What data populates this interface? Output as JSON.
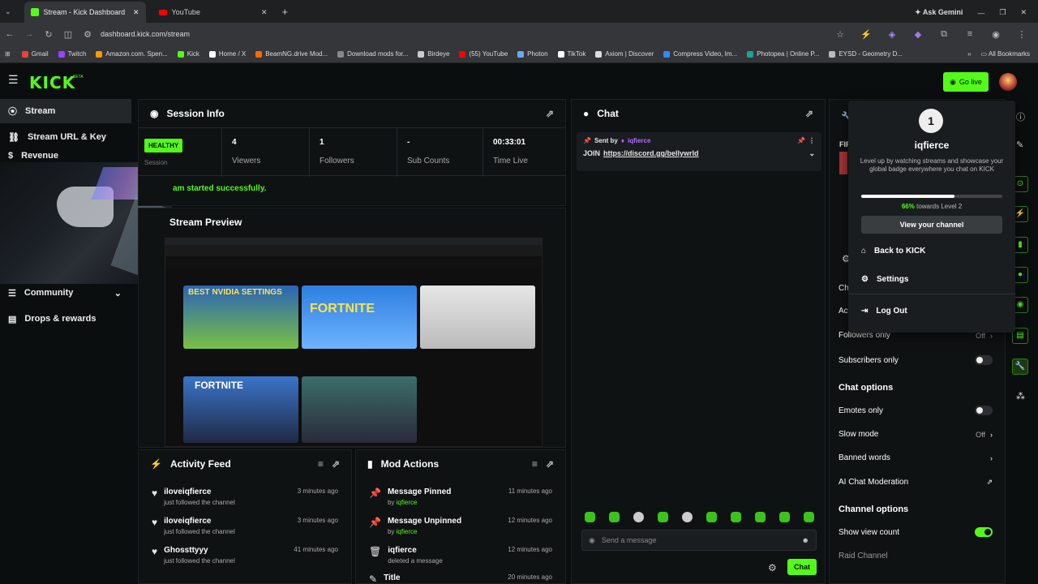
{
  "browser": {
    "tabs": [
      {
        "title": "Stream - Kick Dashboard",
        "active": true,
        "favicon_color": "#53fc18"
      },
      {
        "title": "YouTube",
        "active": false,
        "favicon_color": "#ff0000"
      }
    ],
    "ask_gemini": "Ask Gemini",
    "url": "dashboard.kick.com/stream",
    "bookmarks": [
      {
        "label": "Gmail",
        "color": "#ea4335"
      },
      {
        "label": "Twitch",
        "color": "#9146ff"
      },
      {
        "label": "Amazon.com. Spen...",
        "color": "#ff9900"
      },
      {
        "label": "Kick",
        "color": "#53fc18"
      },
      {
        "label": "Home / X",
        "color": "#ffffff"
      },
      {
        "label": "BeamNG.drive Mod...",
        "color": "#ff6a00"
      },
      {
        "label": "Download mods for...",
        "color": "#888888"
      },
      {
        "label": "Birdeye",
        "color": "#cccccc"
      },
      {
        "label": "(55) YouTube",
        "color": "#ff0000"
      },
      {
        "label": "Photon",
        "color": "#66aaff"
      },
      {
        "label": "TikTok",
        "color": "#ffffff"
      },
      {
        "label": "Axiom | Discover",
        "color": "#dddddd"
      },
      {
        "label": "Compress Video, Im...",
        "color": "#3388ff"
      },
      {
        "label": "Photopea | Online P...",
        "color": "#18a497"
      },
      {
        "label": "EYSD - Geometry D...",
        "color": "#bbbbbb"
      }
    ],
    "all_bookmarks": "All Bookmarks"
  },
  "nav": {
    "logo": "KICK",
    "go_live": "Go live"
  },
  "sidebar": {
    "items": [
      {
        "label": "Stream",
        "icon": "stream-icon"
      },
      {
        "label": "Stream URL & Key",
        "icon": "link-icon"
      },
      {
        "label": "Revenue",
        "icon": "revenue-icon"
      },
      {
        "label": "Community",
        "icon": "community-icon"
      },
      {
        "label": "Drops & rewards",
        "icon": "gift-icon"
      }
    ]
  },
  "session": {
    "title": "Session Info",
    "health": "HEALTHY",
    "health_sub": "Session",
    "stats": [
      {
        "value": "4",
        "label": "Viewers"
      },
      {
        "value": "1",
        "label": "Followers"
      },
      {
        "value": "-",
        "label": "Sub Counts"
      },
      {
        "value": "00:33:01",
        "label": "Time Live"
      }
    ],
    "message": "am started successfully."
  },
  "preview": {
    "title": "Stream Preview",
    "thumb_titles": [
      "BEST NVIDIA SETTINGS",
      "FORTNITE",
      "",
      "FORTNITE",
      ""
    ]
  },
  "chat": {
    "title": "Chat",
    "pinned_prefix": "Sent by",
    "pinned_user": "iqfierce",
    "pinned_text": "JOIN",
    "pinned_link": "https://discord.gg/bellywrld",
    "input_placeholder": "Send a message",
    "send_label": "Chat"
  },
  "activity": {
    "title": "Activity Feed",
    "items": [
      {
        "name": "iloveiqfierce",
        "sub": "just followed the channel",
        "time": "3 minutes ago"
      },
      {
        "name": "iloveiqfierce",
        "sub": "just followed the channel",
        "time": "3 minutes ago"
      },
      {
        "name": "Ghossttyyy",
        "sub": "just followed the channel",
        "time": "41 minutes ago"
      }
    ]
  },
  "mod": {
    "title": "Mod Actions",
    "items": [
      {
        "name": "Message Pinned",
        "by": "by",
        "user": "iqfierce",
        "time": "11 minutes ago"
      },
      {
        "name": "Message Unpinned",
        "by": "by",
        "user": "iqfierce",
        "time": "12 minutes ago"
      },
      {
        "name": "iqfierce",
        "by": "deleted a message",
        "user": "",
        "time": "12 minutes ago"
      },
      {
        "name": "Title",
        "by": "",
        "user": "",
        "time": "20 minutes ago"
      }
    ]
  },
  "settings_panel": {
    "partial_label": "FIF",
    "rows_top": [
      {
        "label": "Ch",
        "value": ""
      },
      {
        "label": "Ac",
        "value": ""
      },
      {
        "label": "Followers only",
        "value": "Off"
      },
      {
        "label": "Subscribers only",
        "value": ""
      }
    ],
    "chat_options_title": "Chat options",
    "chat_options": [
      {
        "label": "Emotes only",
        "value": "",
        "toggle": false
      },
      {
        "label": "Slow mode",
        "value": "Off"
      },
      {
        "label": "Banned words",
        "value": ""
      },
      {
        "label": "AI Chat Moderation",
        "value": ""
      }
    ],
    "channel_options_title": "Channel options",
    "channel_options": [
      {
        "label": "Show view count",
        "toggle": true
      },
      {
        "label": "Raid Channel",
        "value": ""
      }
    ]
  },
  "profile_menu": {
    "level": "1",
    "username": "iqfierce",
    "description": "Level up by watching streams and showcase your global badge everywhere you chat on KICK",
    "progress_percent": 66,
    "progress_label": "66%",
    "progress_suffix": "towards Level 2",
    "view_channel": "View your channel",
    "items": [
      {
        "label": "Back to KICK",
        "icon": "home-icon"
      },
      {
        "label": "Settings",
        "icon": "gear-icon"
      },
      {
        "label": "Log Out",
        "icon": "logout-icon"
      }
    ]
  }
}
